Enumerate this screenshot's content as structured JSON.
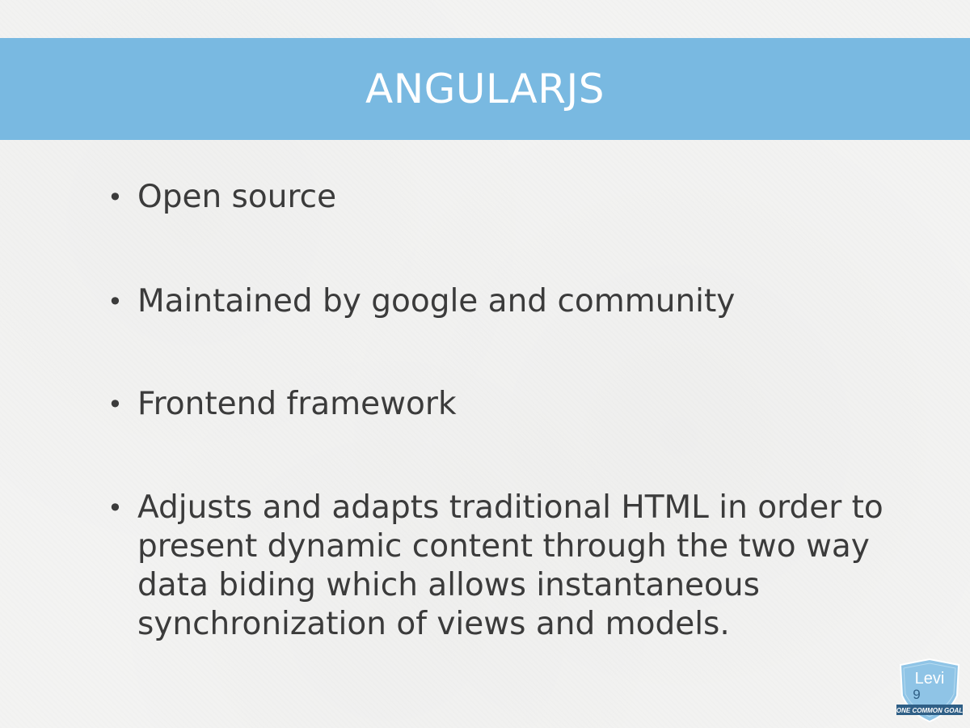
{
  "slide": {
    "title": "ANGULARJS",
    "bullets": [
      "Open source",
      "Maintained by google and community",
      "Frontend framework",
      "Adjusts and adapts traditional HTML in order to present dynamic content through the two way data biding which allows instantaneous synchronization of views and models."
    ],
    "bullet_symbol": "•"
  },
  "logo": {
    "text": "Levi",
    "number": "9",
    "tagline": "ONE COMMON GOAL"
  },
  "colors": {
    "title_band": "#79b9e1",
    "title_text": "#ffffff",
    "body_text": "#3b3b3b",
    "background": "#f3f3f2",
    "logo_shield": "#8fc4e6"
  }
}
